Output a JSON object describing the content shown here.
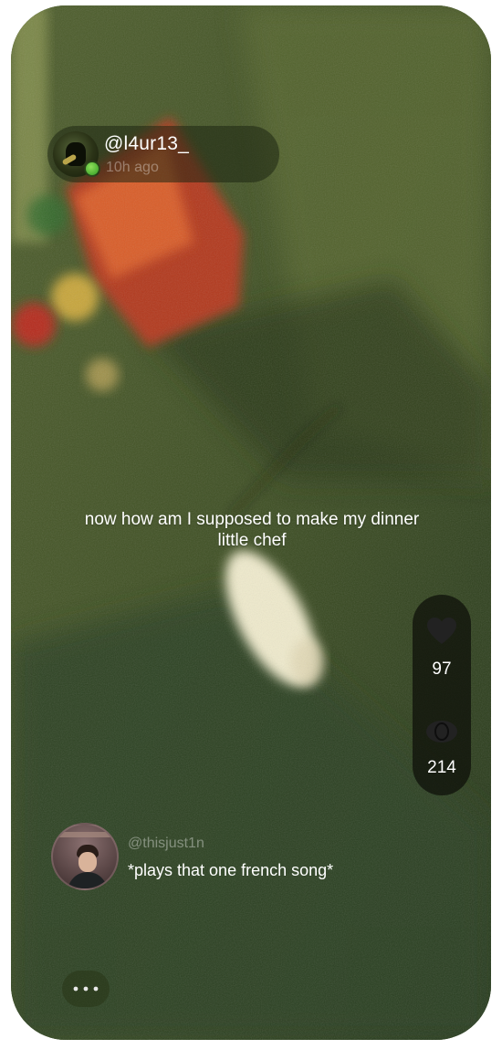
{
  "post": {
    "username": "@l4ur13_",
    "time_ago": "10h ago",
    "caption_line1": "now how am I supposed to make my dinner",
    "caption_line2": "little chef"
  },
  "stats": {
    "likes": "97",
    "views": "214",
    "likes_icon": "heart-icon",
    "views_icon": "eye-icon"
  },
  "comment": {
    "username": "@thisjust1n",
    "text": "*plays that one french song*"
  },
  "more_icon": "ellipsis-icon",
  "colors": {
    "online": "#3fb52c",
    "pill": "#0c0e08",
    "photo_base": "#3e4f22"
  }
}
